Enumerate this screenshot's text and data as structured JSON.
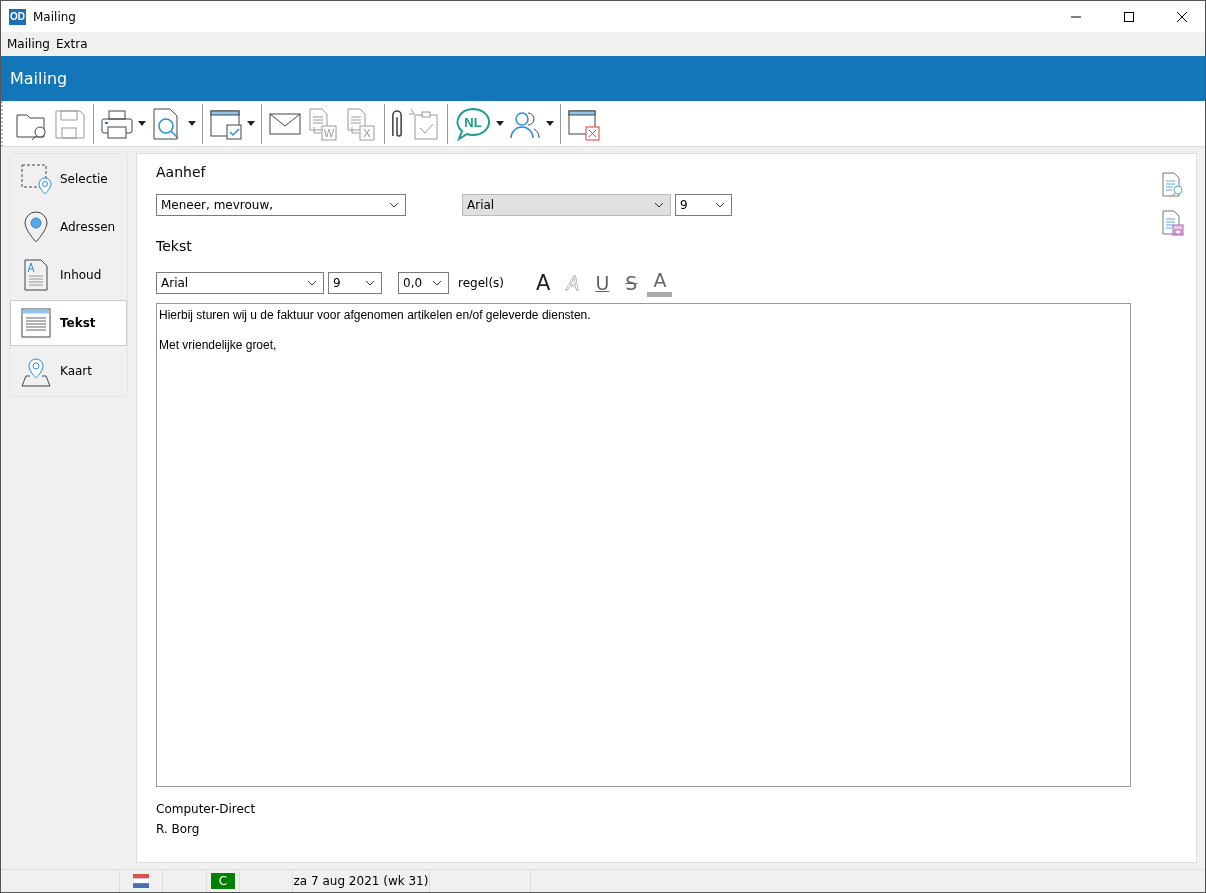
{
  "window": {
    "icon_label": "OD",
    "title": "Mailing"
  },
  "menu": [
    "Mailing",
    "Extra"
  ],
  "header": {
    "title": "Mailing"
  },
  "toolbar": [
    [
      {
        "kind": "open",
        "disabled": false,
        "dropdown": false
      },
      {
        "kind": "save",
        "disabled": true,
        "dropdown": false
      }
    ],
    [
      {
        "kind": "print",
        "disabled": false,
        "dropdown": true
      },
      {
        "kind": "preview",
        "disabled": false,
        "dropdown": true
      }
    ],
    [
      {
        "kind": "window-check",
        "disabled": false,
        "dropdown": true
      }
    ],
    [
      {
        "kind": "mail",
        "disabled": false,
        "dropdown": false
      },
      {
        "kind": "word",
        "disabled": true,
        "dropdown": false,
        "label": "W"
      },
      {
        "kind": "excel",
        "disabled": true,
        "dropdown": false,
        "label": "X"
      }
    ],
    [
      {
        "kind": "attach",
        "disabled": false,
        "dropdown": false
      },
      {
        "kind": "clipboard",
        "disabled": true,
        "dropdown": false
      }
    ],
    [
      {
        "kind": "language",
        "disabled": false,
        "dropdown": true,
        "label": "NL"
      },
      {
        "kind": "users",
        "disabled": false,
        "dropdown": true
      }
    ],
    [
      {
        "kind": "close-window",
        "disabled": false,
        "dropdown": false
      }
    ]
  ],
  "sidebar": {
    "items": [
      {
        "kind": "selection",
        "label": "Selectie",
        "selected": false
      },
      {
        "kind": "pin",
        "label": "Adressen",
        "selected": false
      },
      {
        "kind": "document",
        "label": "Inhoud",
        "selected": false
      },
      {
        "kind": "text",
        "label": "Tekst",
        "selected": true
      },
      {
        "kind": "map",
        "label": "Kaart",
        "selected": false
      }
    ]
  },
  "salutation": {
    "heading": "Aanhef",
    "value": "Meneer, mevrouw,",
    "font": {
      "value": "Arial",
      "disabled": true
    },
    "size": "9"
  },
  "text": {
    "heading": "Tekst",
    "font": "Arial",
    "size": "9",
    "spacing": "0,0",
    "spacing_unit": "regel(s)",
    "format_buttons": [
      {
        "kind": "bold",
        "glyph": "A"
      },
      {
        "kind": "italic",
        "glyph": "A"
      },
      {
        "kind": "underline",
        "glyph": "U"
      },
      {
        "kind": "strike",
        "glyph": "S"
      },
      {
        "kind": "color",
        "glyph": "A"
      }
    ],
    "body": "Hierbij sturen wij u de faktuur voor afgenomen artikelen en/of geleverde diensten.\n\nMet vriendelijke groet,"
  },
  "signature": [
    "Computer-Direct",
    "R. Borg"
  ],
  "side_actions": [
    {
      "kind": "preview"
    },
    {
      "kind": "save"
    }
  ],
  "status_bar": [
    {
      "kind": "empty"
    },
    {
      "kind": "flag"
    },
    {
      "kind": "empty"
    },
    {
      "kind": "badge",
      "text": "C",
      "color": "#008000"
    },
    {
      "kind": "empty"
    },
    {
      "kind": "text",
      "text": "za 7 aug 2021 (wk 31)"
    },
    {
      "kind": "empty"
    }
  ]
}
